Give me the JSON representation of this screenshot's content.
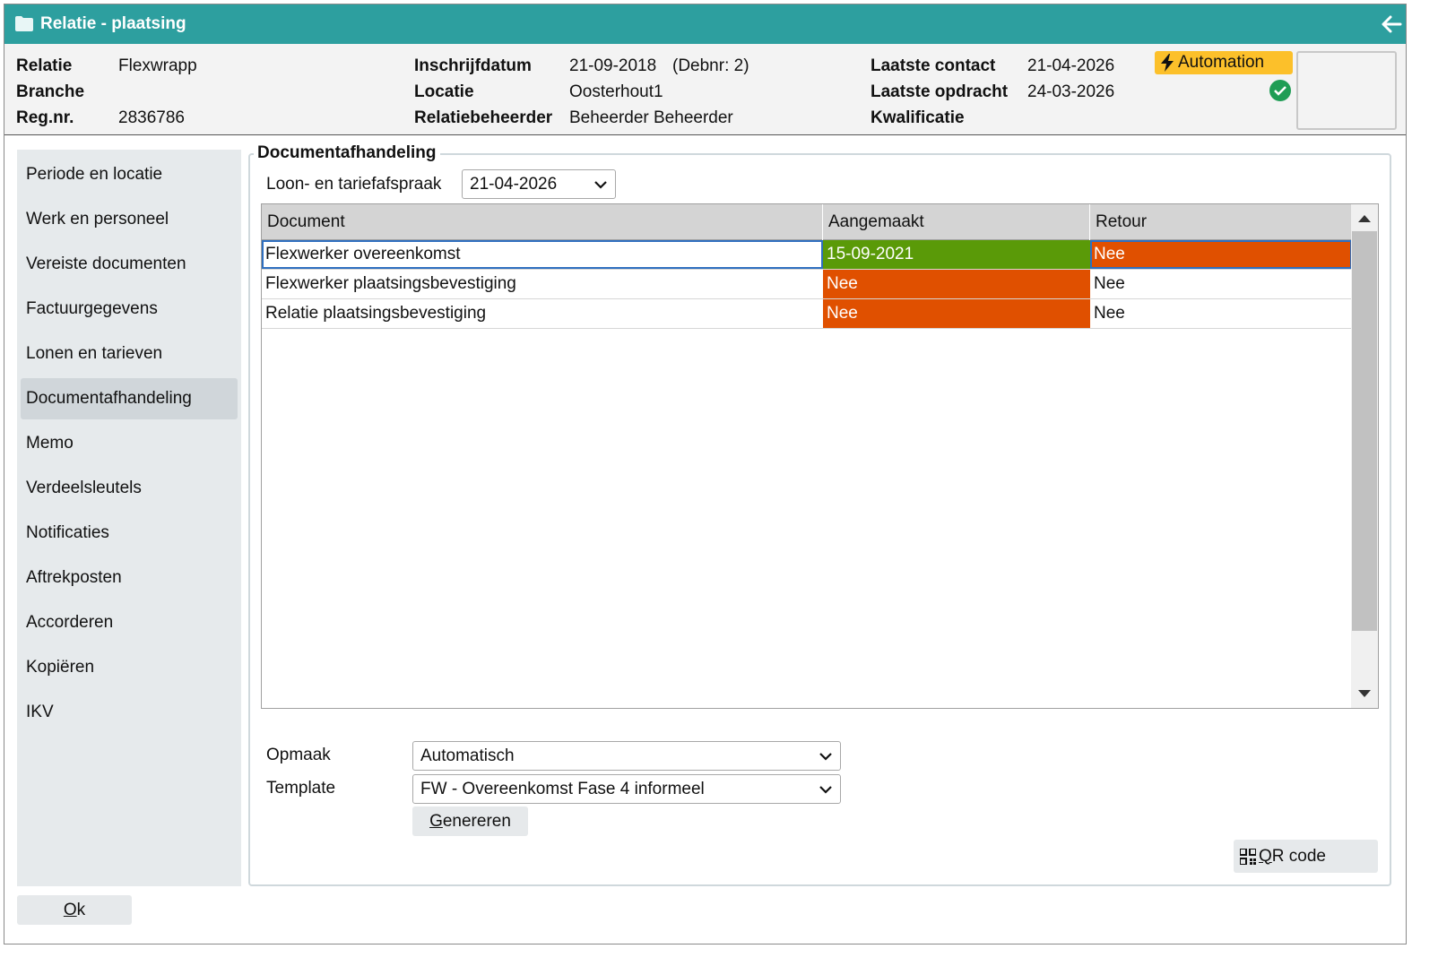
{
  "window": {
    "title": "Relatie - plaatsing"
  },
  "header": {
    "relatie_label": "Relatie",
    "relatie_value": "Flexwrapp",
    "branche_label": "Branche",
    "branche_value": "",
    "regnr_label": "Reg.nr.",
    "regnr_value": "2836786",
    "inschrijf_label": "Inschrijfdatum",
    "inschrijf_value": "21-09-2018",
    "debnr": "(Debnr: 2)",
    "locatie_label": "Locatie",
    "locatie_value": "Oosterhout1",
    "beheerder_label": "Relatiebeheerder",
    "beheerder_value": "Beheerder Beheerder",
    "contact_label": "Laatste contact",
    "contact_value": "21-04-2026",
    "opdracht_label": "Laatste opdracht",
    "opdracht_value": "24-03-2026",
    "kwalificatie_label": "Kwalificatie",
    "kwalificatie_value": "",
    "automation_badge": "Automation"
  },
  "sidebar": {
    "items": [
      {
        "label": "Periode en locatie"
      },
      {
        "label": "Werk en personeel"
      },
      {
        "label": "Vereiste documenten"
      },
      {
        "label": "Factuurgegevens"
      },
      {
        "label": "Lonen en tarieven"
      },
      {
        "label": "Documentafhandeling"
      },
      {
        "label": "Memo"
      },
      {
        "label": "Verdeelsleutels"
      },
      {
        "label": "Notificaties"
      },
      {
        "label": "Aftrekposten"
      },
      {
        "label": "Accorderen"
      },
      {
        "label": "Kopiëren"
      },
      {
        "label": "IKV"
      }
    ],
    "active": "Documentafhandeling"
  },
  "section": {
    "legend": "Documentafhandeling",
    "afspraak_label": "Loon- en tariefafspraak",
    "afspraak_value": "21-04-2026"
  },
  "grid": {
    "columns": [
      "Document",
      "Aangemaakt",
      "Retour"
    ],
    "rows": [
      {
        "document": "Flexwerker overeenkomst",
        "aangemaakt": "15-09-2021",
        "retour": "Nee"
      },
      {
        "document": "Flexwerker plaatsingsbevestiging",
        "aangemaakt": "Nee",
        "retour": "Nee"
      },
      {
        "document": "Relatie plaatsingsbevestiging",
        "aangemaakt": "Nee",
        "retour": "Nee"
      }
    ]
  },
  "form": {
    "opmaak_label": "Opmaak",
    "opmaak_value": "Automatisch",
    "template_label": "Template",
    "template_value": "FW - Overeenkomst Fase 4 informeel",
    "generate_first": "G",
    "generate_rest": "enereren"
  },
  "qr": {
    "first": "Q",
    "rest": "R code"
  },
  "ok": {
    "first": "O",
    "rest": "k"
  },
  "colors": {
    "teal": "#2d9f9f",
    "green": "#5a9a08",
    "orange": "#e05000",
    "badge": "#fcc02a"
  },
  "icons": [
    "folder-icon",
    "back-arrow-icon",
    "lightning-icon",
    "check-circle-icon",
    "chevron-down-icon",
    "qr-code-icon",
    "scroll-up-icon",
    "scroll-down-icon"
  ]
}
